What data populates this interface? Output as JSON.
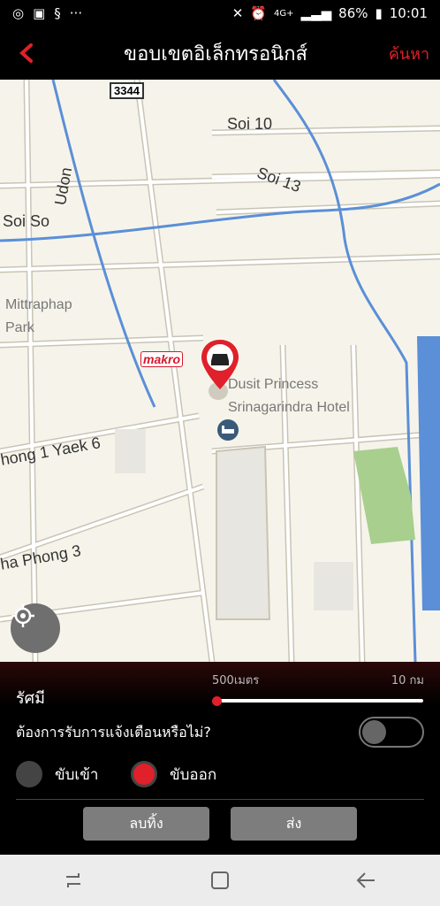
{
  "status": {
    "battery": "86%",
    "time": "10:01",
    "network": "4G+"
  },
  "header": {
    "title": "ขอบเขตอิเล็กทรอนิกส์",
    "search_label": "ค้นหา"
  },
  "map": {
    "road_shield": "3344",
    "labels": [
      "Soi 10",
      "Soi 13",
      "Soi So",
      "Udon",
      "Mittraphap",
      "Park",
      "hong 1 Yaek 6",
      "ha Phong 3"
    ],
    "poi": {
      "brand": "makro",
      "hotel_name_line1": "Dusit Princess",
      "hotel_name_line2": "Srinagarindra Hotel"
    }
  },
  "panel": {
    "radius_label": "รัศมี",
    "range_min": "500เมตร",
    "range_max": "10 กม",
    "slider_fraction": 0.0,
    "notify_label": "ต้องการรับการแจ้งเตือนหรือไม่?",
    "notify_on": false,
    "radio_enter": "ขับเข้า",
    "radio_exit": "ขับออก",
    "selected_radio": "exit",
    "delete_label": "ลบทิ้ง",
    "send_label": "ส่ง"
  },
  "colors": {
    "accent": "#e0202a",
    "water": "#5b8fd8",
    "park": "#a8cf8e"
  }
}
